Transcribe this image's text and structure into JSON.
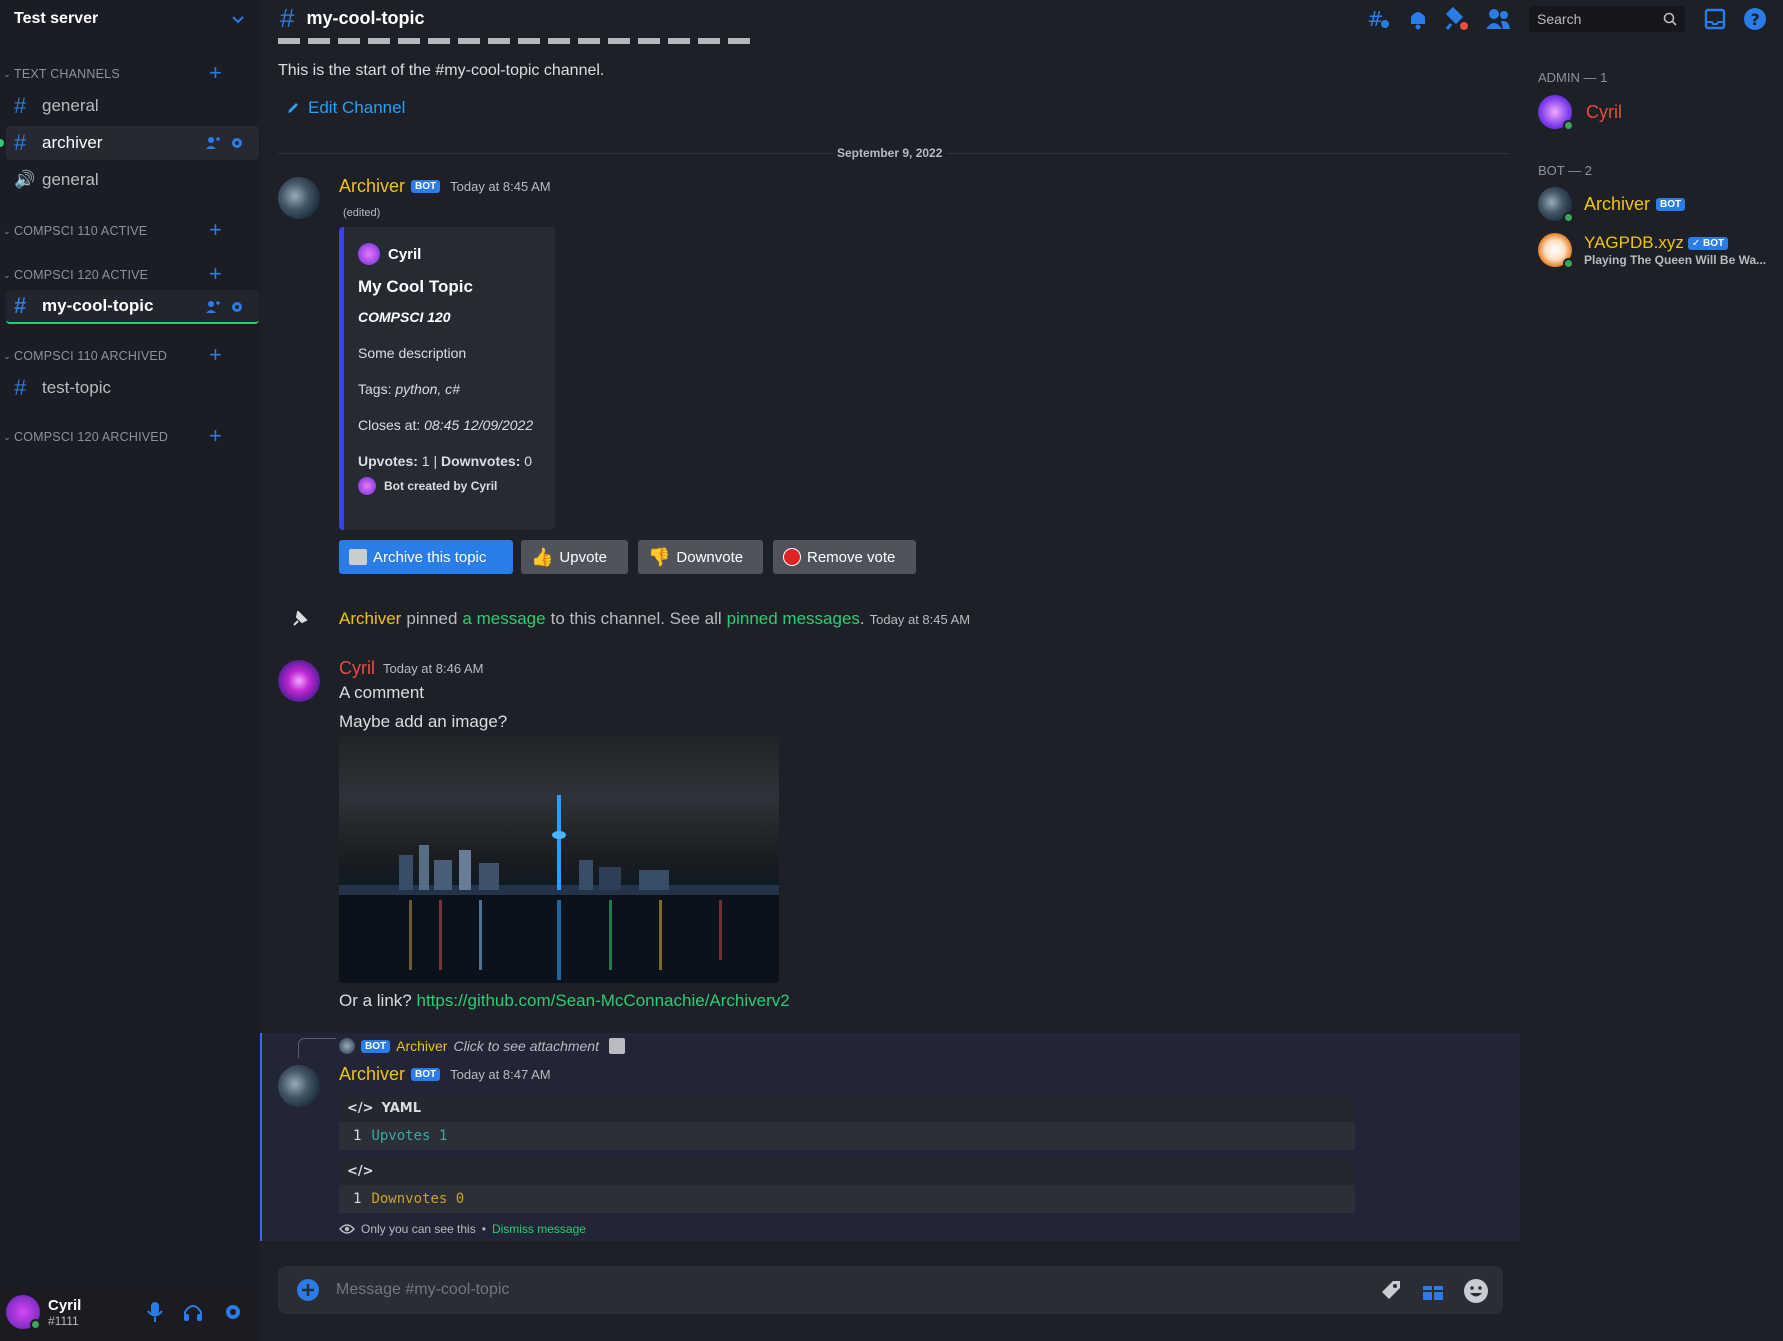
{
  "server": {
    "name": "Test server"
  },
  "sidebar": {
    "categories": [
      {
        "label": "TEXT CHANNELS"
      },
      {
        "label": "COMPSCI 110 ACTIVE"
      },
      {
        "label": "COMPSCI 120 ACTIVE"
      },
      {
        "label": "COMPSCI 110 ARCHIVED"
      },
      {
        "label": "COMPSCI 120 ARCHIVED"
      }
    ],
    "channels": [
      {
        "label": "general"
      },
      {
        "label": "archiver"
      },
      {
        "label": "general"
      },
      {
        "label": "my-cool-topic"
      },
      {
        "label": "test-topic"
      }
    ]
  },
  "user": {
    "name": "Cyril",
    "tag": "#1111"
  },
  "topbar": {
    "channel": "my-cool-topic",
    "search_placeholder": "Search"
  },
  "channel_intro": {
    "text": "This is the start of the #my-cool-topic channel.",
    "edit": "Edit Channel"
  },
  "date_divider": "September 9, 2022",
  "messages": {
    "m1": {
      "author": "Archiver",
      "badge": "BOT",
      "time": "Today at 8:45 AM",
      "edited": "(edited)"
    },
    "embed": {
      "author": "Cyril",
      "title": "My Cool Topic",
      "subtitle": "COMPSCI 120",
      "description": "Some description",
      "tags_label": "Tags:",
      "tags_value": "python, c#",
      "closes_label": "Closes at:",
      "closes_value": "08:45 12/09/2022",
      "upvotes_label": "Upvotes:",
      "upvotes_value": "1",
      "separator": "|",
      "downvotes_label": "Downvotes:",
      "downvotes_value": "0",
      "footer": "Bot created by Cyril"
    },
    "buttons": {
      "archive": "Archive this topic",
      "upvote": "Upvote",
      "downvote": "Downvote",
      "remove": "Remove vote"
    },
    "pin": {
      "author": "Archiver",
      "t1": "pinned",
      "link1": "a message",
      "t2": "to this channel. See all",
      "link2": "pinned messages",
      "t3": ".",
      "time": "Today at 8:45 AM"
    },
    "m2": {
      "author": "Cyril",
      "time": "Today at 8:46 AM",
      "line1": "A comment",
      "line2": "Maybe add an image?",
      "line3_prefix": "Or a link?",
      "link": "https://github.com/Sean-McConnachie/Archiverv2"
    },
    "m3": {
      "reply_badge": "BOT",
      "reply_author": "Archiver",
      "reply_text": "Click to see attachment",
      "author": "Archiver",
      "badge": "BOT",
      "time": "Today at 8:47 AM",
      "code1_lang": "YAML",
      "code1_line_no": "1",
      "code1_line": "Upvotes 1",
      "code2_line_no": "1",
      "code2_line": "Downvotes 0",
      "ephemeral_note": "Only you can see this",
      "bullet": "•",
      "dismiss": "Dismiss message"
    }
  },
  "composer": {
    "placeholder": "Message #my-cool-topic"
  },
  "members": {
    "admin_header": "ADMIN — 1",
    "bot_header": "BOT — 2",
    "admin": [
      {
        "name": "Cyril"
      }
    ],
    "bots": [
      {
        "name": "Archiver",
        "badge": "BOT"
      },
      {
        "name": "YAGPDB.xyz",
        "badge": "✓ BOT",
        "status": "Playing The Queen Will Be Wa..."
      }
    ]
  },
  "colors": {
    "accent": "#2a7de6",
    "bot_name": "#f1c40f",
    "admin_name": "#e74c3c",
    "link": "#2ecc71",
    "online": "#3ba55c"
  }
}
